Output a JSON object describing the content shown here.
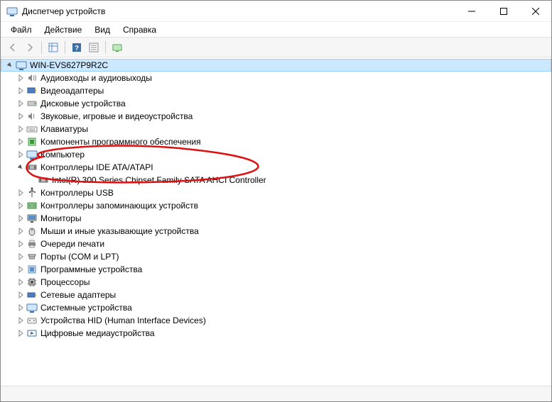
{
  "window": {
    "title": "Диспетчер устройств"
  },
  "menubar": {
    "file": "Файл",
    "action": "Действие",
    "view": "Вид",
    "help": "Справка"
  },
  "tree": {
    "root": "WIN-EVS627P9R2C",
    "n0": "Аудиовходы и аудиовыходы",
    "n1": "Видеоадаптеры",
    "n2": "Дисковые устройства",
    "n3": "Звуковые, игровые и видеоустройства",
    "n4": "Клавиатуры",
    "n5": "Компоненты программного обеспечения",
    "n6": "Компьютер",
    "n7": "Контроллеры IDE ATA/ATAPI",
    "n7c0": "Intel(R) 300 Series Chipset Family SATA AHCI Controller",
    "n8": "Контроллеры USB",
    "n9": "Контроллеры запоминающих устройств",
    "n10": "Мониторы",
    "n11": "Мыши и иные указывающие устройства",
    "n12": "Очереди печати",
    "n13": "Порты (COM и LPT)",
    "n14": "Программные устройства",
    "n15": "Процессоры",
    "n16": "Сетевые адаптеры",
    "n17": "Системные устройства",
    "n18": "Устройства HID (Human Interface Devices)",
    "n19": "Цифровые медиаустройства"
  }
}
